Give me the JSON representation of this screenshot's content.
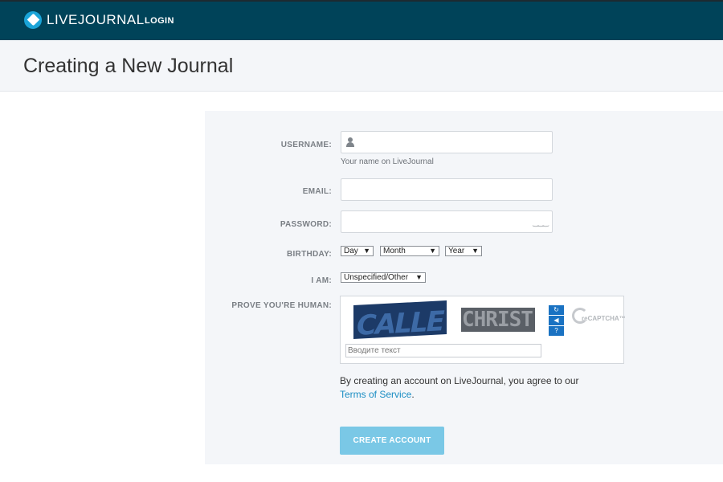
{
  "header": {
    "brand": "LIVEJOURNAL",
    "login_label": "LOGIN"
  },
  "page": {
    "title": "Creating a New Journal"
  },
  "form": {
    "username": {
      "label": "USERNAME:",
      "value": "",
      "hint": "Your name on LiveJournal"
    },
    "email": {
      "label": "EMAIL:",
      "value": ""
    },
    "password": {
      "label": "PASSWORD:",
      "value": ""
    },
    "birthday": {
      "label": "BIRTHDAY:",
      "day": "Day",
      "month": "Month",
      "year": "Year"
    },
    "gender": {
      "label": "I AM:",
      "value": "Unspecified/Other"
    },
    "captcha": {
      "label": "PROVE YOU'RE HUMAN:",
      "word1": "CALLE",
      "word2": "CHRIST",
      "input_placeholder": "Вводите текст",
      "logo_text": "reCAPTCHA™"
    },
    "terms_text": "By creating an account on LiveJournal, you agree to our",
    "terms_link": "Terms of Service",
    "terms_end": ".",
    "submit_label": "CREATE ACCOUNT"
  },
  "colors": {
    "header_bg": "#004359",
    "accent": "#1a8dc3",
    "button_bg": "#7ac8e6"
  }
}
